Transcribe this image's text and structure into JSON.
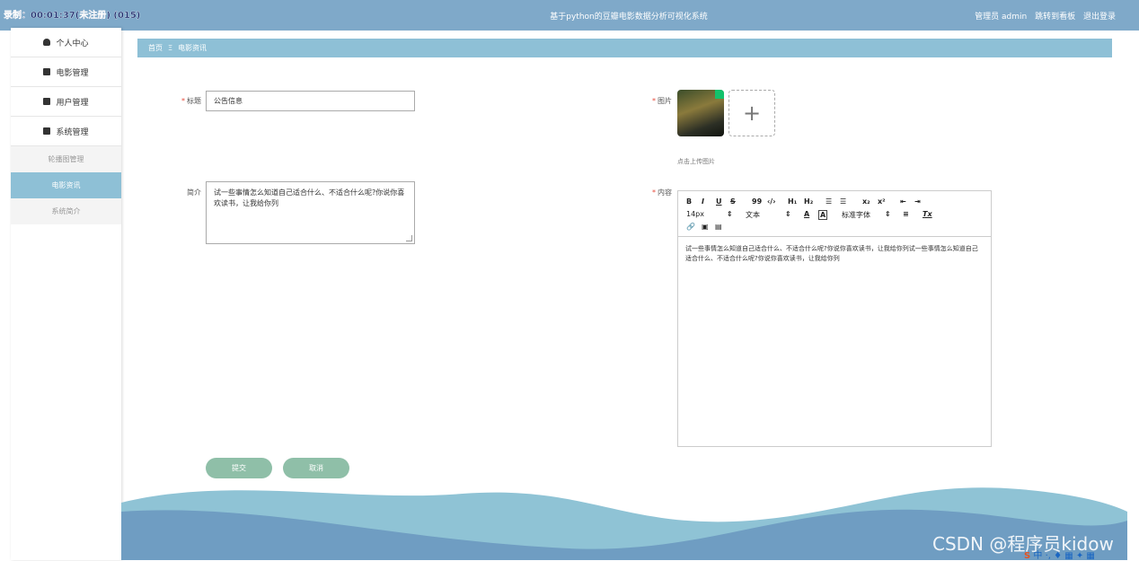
{
  "recording_overlay": "录制：00:01:37(未注册) (015)",
  "header": {
    "title": "基于python的豆瓣电影数据分析可视化系统",
    "links": [
      "管理员 admin",
      "跳转到看板",
      "退出登录"
    ]
  },
  "sidebar": {
    "items": [
      {
        "label": "个人中心",
        "icon": "user-icon"
      },
      {
        "label": "电影管理",
        "icon": "monitor-icon"
      },
      {
        "label": "用户管理",
        "icon": "clipboard-icon"
      },
      {
        "label": "系统管理",
        "icon": "clipboard-icon"
      }
    ],
    "subitems": [
      {
        "label": "轮播图管理"
      },
      {
        "label": "电影资讯"
      },
      {
        "label": "系统简介"
      }
    ]
  },
  "breadcrumb": {
    "home": "首页",
    "separator": "Ξ",
    "current": "电影资讯"
  },
  "form": {
    "title_label": "标题",
    "title_value": "公告信息",
    "summary_label": "简介",
    "summary_value": "试一些事情怎么知道自己适合什么、不适合什么呢?你说你喜欢读书，让我给你列",
    "image_label": "图片",
    "upload_tip": "点击上传图片",
    "content_label": "内容",
    "content_value": "试一些事情怎么知道自己适合什么、不适合什么呢?你说你喜欢读书，让我给你列试一些事情怎么知道自己适合什么、不适合什么呢?你说你喜欢读书，让我给你列",
    "submit_label": "提交",
    "cancel_label": "取消"
  },
  "editor_toolbar": {
    "bold": "B",
    "italic": "I",
    "underline": "U",
    "strike": "S",
    "quote": "99",
    "code": "‹/›",
    "h1": "H₁",
    "h2": "H₂",
    "ordered": "☰",
    "bullet": "☰",
    "sub": "x₂",
    "sup": "x²",
    "outdent": "⇤",
    "indent": "⇥",
    "size_value": "14px",
    "header_value": "文本",
    "color": "A",
    "background": "A",
    "font_value": "标准字体",
    "align": "≡",
    "clean": "Tx"
  },
  "watermark": "CSDN @程序员kidow",
  "colors": {
    "topbar": "#7fa9c9",
    "breadcrumb": "#8ec0d6",
    "button": "#8fbfa8",
    "wave_dark": "#6f9dc2",
    "wave_light": "#8fc3d5"
  }
}
